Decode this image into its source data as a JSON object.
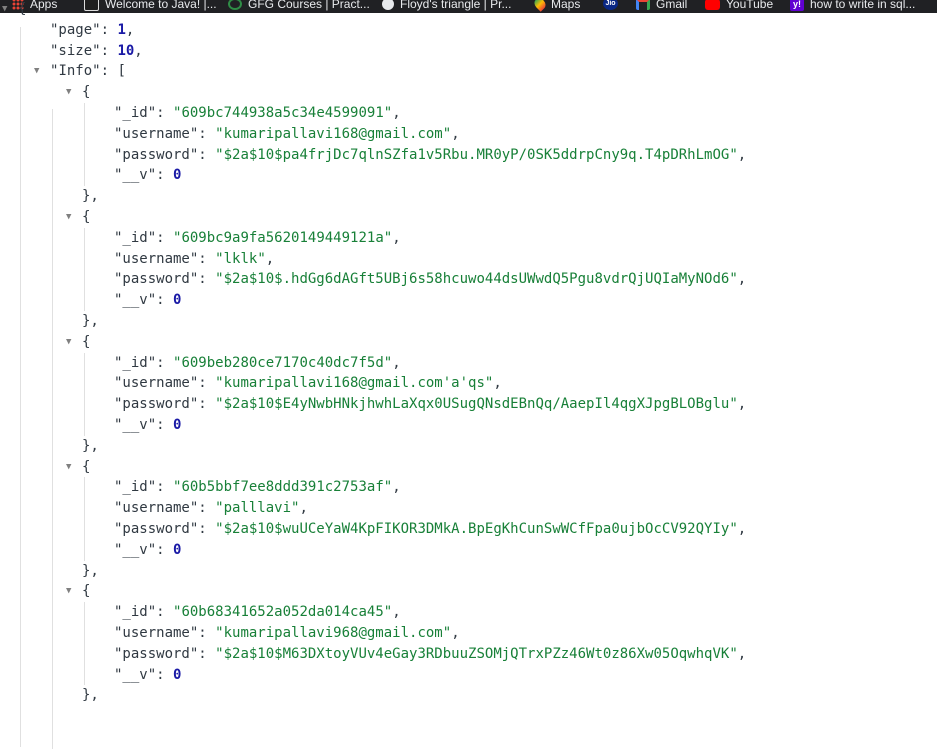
{
  "bookmarks": [
    {
      "label": "Apps",
      "icon": "apps-grid-icon"
    },
    {
      "label": "Welcome to Java! |...",
      "icon": "java-icon"
    },
    {
      "label": "GFG Courses | Pract...",
      "icon": "gfg-icon"
    },
    {
      "label": "Floyd's triangle | Pr...",
      "icon": "floyd-site-icon"
    },
    {
      "label": "Maps",
      "icon": "maps-pin-icon"
    },
    {
      "label": "",
      "icon": "jio-icon",
      "icon_text": "Jio"
    },
    {
      "label": "Gmail",
      "icon": "gmail-icon"
    },
    {
      "label": "YouTube",
      "icon": "youtube-icon"
    },
    {
      "label": "how to write in sql...",
      "icon": "yahoo-icon",
      "icon_text": "y!"
    }
  ],
  "json": {
    "page": 1,
    "size": 10,
    "info_key": "Info",
    "items": [
      {
        "_id": "609bc744938a5c34e4599091",
        "username": "kumaripallavi168@gmail.com",
        "password": "$2a$10$pa4frjDc7qlnSZfa1v5Rbu.MR0yP/0SK5ddrpCny9q.T4pDRhLmOG",
        "__v": 0
      },
      {
        "_id": "609bc9a9fa5620149449121a",
        "username": "lklk",
        "password": "$2a$10$.hdGg6dAGft5UBj6s58hcuwo44dsUWwdQ5Pgu8vdrQjUQIaMyNOd6",
        "__v": 0
      },
      {
        "_id": "609beb280ce7170c40dc7f5d",
        "username": "kumaripallavi168@gmail.com'a'qs",
        "password": "$2a$10$E4yNwbHNkjhwhLaXqx0USugQNsdEBnQq/AaepIl4qgXJpgBLOBglu",
        "__v": 0
      },
      {
        "_id": "60b5bbf7ee8ddd391c2753af",
        "username": "palllavi",
        "password": "$2a$10$wuUCeYaW4KpFIKOR3DMkA.BpEgKhCunSwWCfFpa0ujbOcCV92QYIy",
        "__v": 0
      },
      {
        "_id": "60b68341652a052da014ca45",
        "username": "kumaripallavi968@gmail.com",
        "password": "$2a$10$M63DXtoyVUv4eGay3RDbuuZSOMjQTrxPZz46Wt0z86Xw05OqwhqVK",
        "__v": 0
      }
    ]
  },
  "colors": {
    "key": "#303942",
    "string": "#188038",
    "number": "#1a1aa6",
    "bookmarks_bg": "#202124"
  }
}
